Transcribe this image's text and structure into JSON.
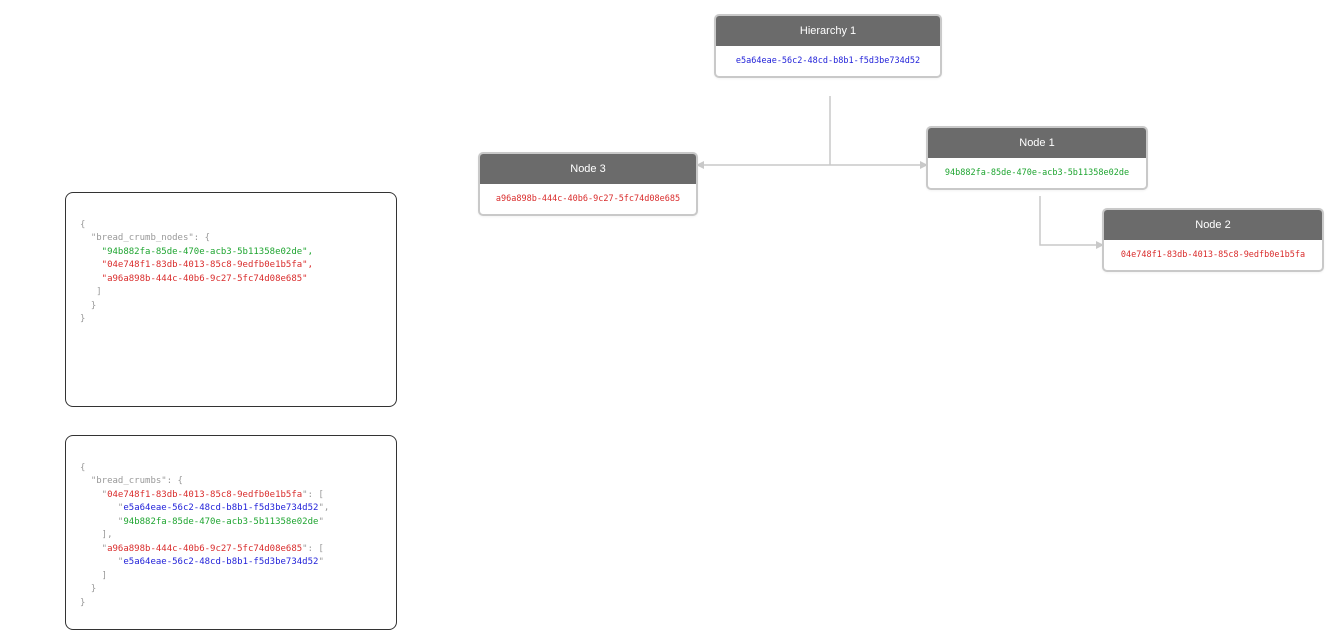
{
  "panel1": {
    "prefix1": "{",
    "prefix2": "  \"bread_crumb_nodes\": {",
    "line1": "    \"94b882fa-85de-470e-acb3-5b11358e02de\",",
    "line2": "    \"04e748f1-83db-4013-85c8-9edfb0e1b5fa\",",
    "line3": "    \"a96a898b-444c-40b6-9c27-5fc74d08e685\"",
    "close1": "   ]",
    "close2": "  }",
    "close3": "}"
  },
  "panel2": {
    "prefix1": "{",
    "prefix2": "  \"bread_crumbs\": {",
    "key1_prefix": "    \"",
    "key1": "04e748f1-83db-4013-85c8-9edfb0e1b5fa",
    "key1_suffix": "\": [",
    "val1a_prefix": "       \"",
    "val1a": "e5a64eae-56c2-48cd-b8b1-f5d3be734d52",
    "val1a_suffix": "\",",
    "val1b_prefix": "       \"",
    "val1b": "94b882fa-85de-470e-acb3-5b11358e02de",
    "val1b_suffix": "\"",
    "arr_close1": "    ],",
    "key2_prefix": "    \"",
    "key2": "a96a898b-444c-40b6-9c27-5fc74d08e685",
    "key2_suffix": "\": [",
    "val2a_prefix": "       \"",
    "val2a": "e5a64eae-56c2-48cd-b8b1-f5d3be734d52",
    "val2a_suffix": "\"",
    "arr_close2": "    ]",
    "close2": "  }",
    "close3": "}"
  },
  "nodes": {
    "root": {
      "title": "Hierarchy 1",
      "uuid": "e5a64eae-56c2-48cd-b8b1-f5d3be734d52",
      "color": "blue"
    },
    "node1": {
      "title": "Node 1",
      "uuid": "94b882fa-85de-470e-acb3-5b11358e02de",
      "color": "green"
    },
    "node2": {
      "title": "Node 2",
      "uuid": "04e748f1-83db-4013-85c8-9edfb0e1b5fa",
      "color": "red"
    },
    "node3": {
      "title": "Node 3",
      "uuid": "a96a898b-444c-40b6-9c27-5fc74d08e685",
      "color": "red"
    }
  }
}
